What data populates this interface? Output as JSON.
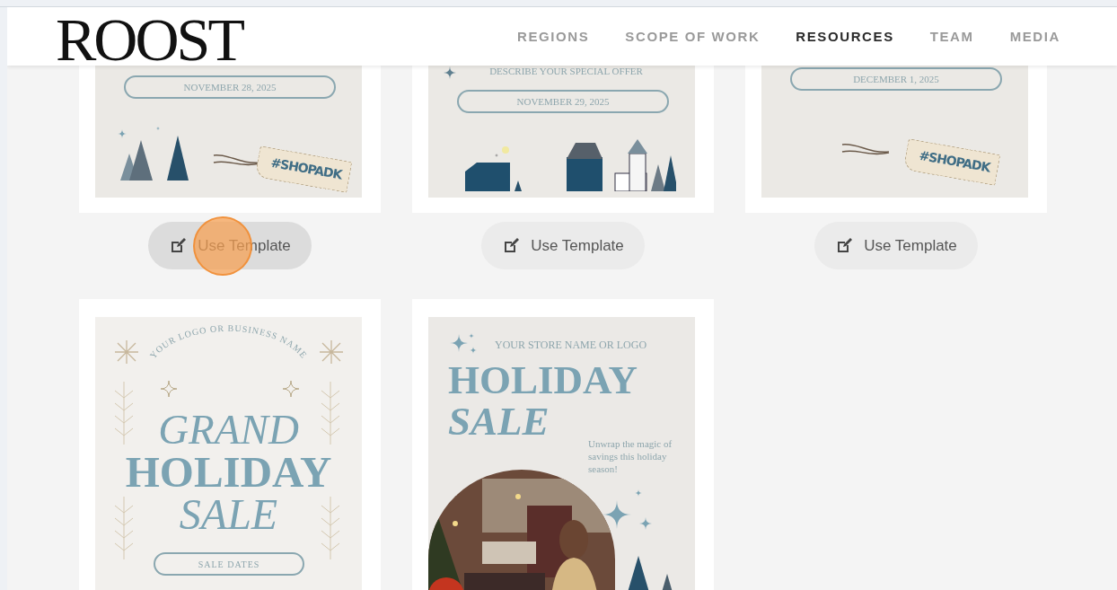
{
  "header": {
    "logo": "ROOST",
    "nav": [
      {
        "label": "REGIONS",
        "selected": false
      },
      {
        "label": "SCOPE OF WORK",
        "selected": false
      },
      {
        "label": "RESOURCES",
        "selected": true
      },
      {
        "label": "TEAM",
        "selected": false
      },
      {
        "label": "MEDIA",
        "selected": false
      }
    ]
  },
  "templates": [
    {
      "kind": "trees-tag",
      "date": "NOVEMBER 28, 2025",
      "tag": "#SHOPADK",
      "button": "Use Template",
      "hovered": true
    },
    {
      "kind": "village",
      "offer": "DESCRIBE YOUR SPECIAL OFFER",
      "date": "NOVEMBER 29, 2025",
      "button": "Use Template",
      "hovered": false
    },
    {
      "kind": "grid-tag",
      "date": "DECEMBER 1, 2025",
      "tag": "#SHOPADK",
      "button": "Use Template",
      "hovered": false
    },
    {
      "kind": "grand-sale",
      "arc_text": "YOUR LOGO OR BUSINESS NAME",
      "headline": [
        "GRAND",
        "HOLIDAY",
        "SALE"
      ],
      "dates": "SALE DATES"
    },
    {
      "kind": "photo-sale",
      "store": "YOUR STORE NAME OR LOGO",
      "headline": [
        "HOLIDAY",
        "SALE"
      ],
      "blurb": "Unwrap the magic of savings this holiday season!"
    }
  ]
}
